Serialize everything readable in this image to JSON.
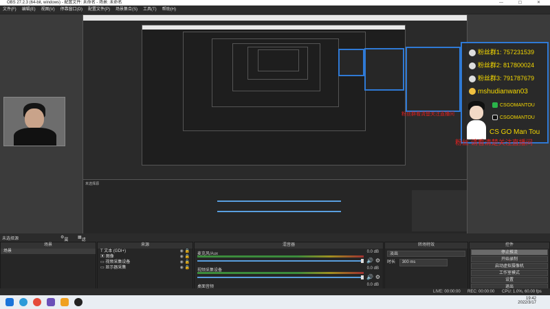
{
  "window": {
    "title": "OBS 27.2.3 (64-bit, windows) - 配置文件: 未命名 - 场景: 未命名"
  },
  "menu": [
    "文件(F)",
    "编辑(E)",
    "视图(V)",
    "停靠窗口(D)",
    "配置文件(P)",
    "场景集合(S)",
    "工具(T)",
    "帮助(H)"
  ],
  "overlay": {
    "fans": [
      {
        "label": "粉丝群1: ",
        "value": "757231539"
      },
      {
        "label": "粉丝群2: ",
        "value": "817800024"
      },
      {
        "label": "粉丝群3: ",
        "value": "791787679"
      }
    ],
    "streamer_name": "mshudianwan03",
    "wechat": "CSGOMANTOU",
    "douyin": "CSGOMANTOU",
    "handle": "CS GO Man Tou",
    "red_caption": "粉丝 请看清楚关注直播间"
  },
  "nested_red_caption": "粉丝群看清楚关注直播间",
  "preview_label": "未选择源",
  "scene_bar": {
    "label": "未选择源",
    "properties": "属性",
    "filters": "滤镜"
  },
  "scenes": {
    "header": "场景",
    "items": [
      "场景"
    ]
  },
  "sources": {
    "header": "来源",
    "items": [
      {
        "icon": "T",
        "name": "文本 (GDI+)"
      },
      {
        "icon": "▣",
        "name": "图像"
      },
      {
        "icon": "▭",
        "name": "视频采集设备"
      },
      {
        "icon": "▭",
        "name": "显示器采集"
      }
    ]
  },
  "mixer": {
    "header": "混音器",
    "channels": [
      {
        "name": "麦克风/Aux",
        "db": "0.0 dB",
        "level_pct": 98
      },
      {
        "name": "视频采集设备",
        "db": "0.0 dB",
        "level_pct": 98
      },
      {
        "name": "桌面音频",
        "db": "0.0 dB",
        "level_pct": 98
      }
    ]
  },
  "transitions": {
    "header": "转场特效",
    "type": "淡出",
    "duration_label": "时长",
    "duration_value": "300 ms"
  },
  "controls": {
    "header": "控件",
    "buttons": [
      "停止推流",
      "开始录制",
      "启动虚拟摄像机",
      "工作室模式",
      "设置",
      "退出"
    ]
  },
  "status": {
    "live": "LIVE: 00:00:00",
    "rec": "REC: 00:00:00",
    "cpu": "CPU: 1.0%, 60.00 fps"
  },
  "taskbar": {
    "time": "19:42",
    "date": "2022/3/17"
  },
  "colors": {
    "accent_blue": "#2f7ad6",
    "fan_yellow": "#f5d800",
    "red": "#e02020"
  }
}
